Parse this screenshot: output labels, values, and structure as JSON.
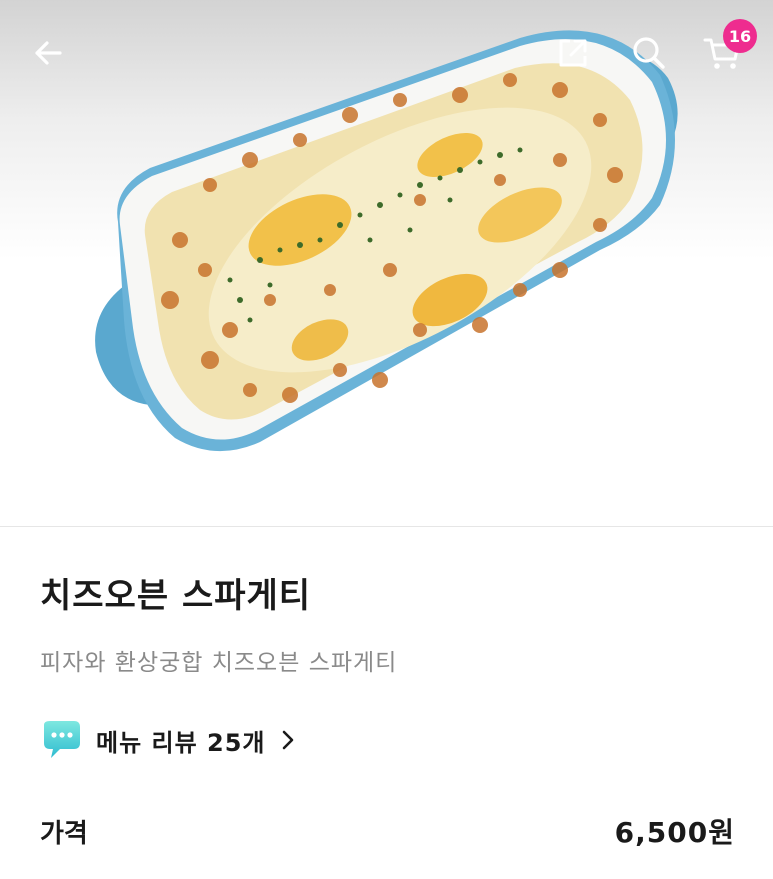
{
  "header": {
    "back_icon": "arrow-left-icon",
    "share_icon": "share-external-icon",
    "search_icon": "search-icon",
    "cart_icon": "cart-icon",
    "cart_count": "16",
    "badge_color": "#ee2c8f"
  },
  "product": {
    "image_alt": "cheese oven spaghetti in blue baking dish",
    "name": "치즈오븐 스파게티",
    "description": "피자와 환상궁합 치즈오븐 스파게티"
  },
  "reviews": {
    "icon": "speech-bubble-icon",
    "label": "메뉴 리뷰 25개",
    "chevron_icon": "chevron-right-icon",
    "accent": "#3fd3d3"
  },
  "price": {
    "label": "가격",
    "value": "6,500원"
  }
}
